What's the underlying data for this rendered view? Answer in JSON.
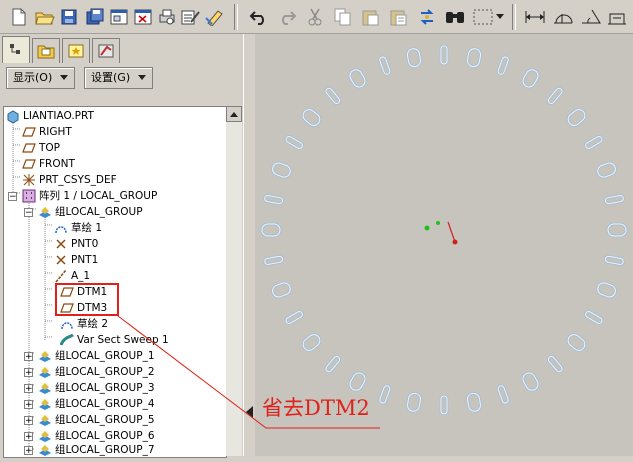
{
  "toolbar": {
    "icons": [
      "new-file-icon",
      "open-icon",
      "save-icon",
      "save-copy-icon",
      "window-icon",
      "close-window-icon",
      "print-icon",
      "regen-icon",
      "edit-icon",
      "undo-icon",
      "redo-icon",
      "cut-icon",
      "copy-icon",
      "paste-icon",
      "paste-special-icon",
      "regenerate-icon",
      "find-icon",
      "select-box-icon",
      "dropdown-icon",
      "dimension-icon",
      "measure-icon",
      "angle-icon",
      "tools-icon"
    ]
  },
  "nav": {
    "show_label": "显示(O)",
    "settings_label": "设置(G)"
  },
  "tree": {
    "items": [
      {
        "label": "LIANTIAO.PRT"
      },
      {
        "label": "RIGHT"
      },
      {
        "label": "TOP"
      },
      {
        "label": "FRONT"
      },
      {
        "label": "PRT_CSYS_DEF"
      },
      {
        "label": "阵列 1 / LOCAL_GROUP"
      },
      {
        "label": "组LOCAL_GROUP"
      },
      {
        "label": "草绘 1"
      },
      {
        "label": "PNT0"
      },
      {
        "label": "PNT1"
      },
      {
        "label": "A_1"
      },
      {
        "label": "DTM1"
      },
      {
        "label": "DTM3"
      },
      {
        "label": "草绘 2"
      },
      {
        "label": "Var Sect Sweep 1"
      },
      {
        "label": "组LOCAL_GROUP_1"
      },
      {
        "label": "组LOCAL_GROUP_2"
      },
      {
        "label": "组LOCAL_GROUP_3"
      },
      {
        "label": "组LOCAL_GROUP_4"
      },
      {
        "label": "组LOCAL_GROUP_5"
      },
      {
        "label": "组LOCAL_GROUP_6"
      },
      {
        "label": "组LOCAL_GROUP_7"
      }
    ]
  },
  "annotation": {
    "text": "省去DTM2",
    "color": "#e0201a"
  },
  "colors": {
    "highlight_box": "#e0201a",
    "chain": "#a9bfd2",
    "viewport_bg": "#c6c4bc"
  }
}
